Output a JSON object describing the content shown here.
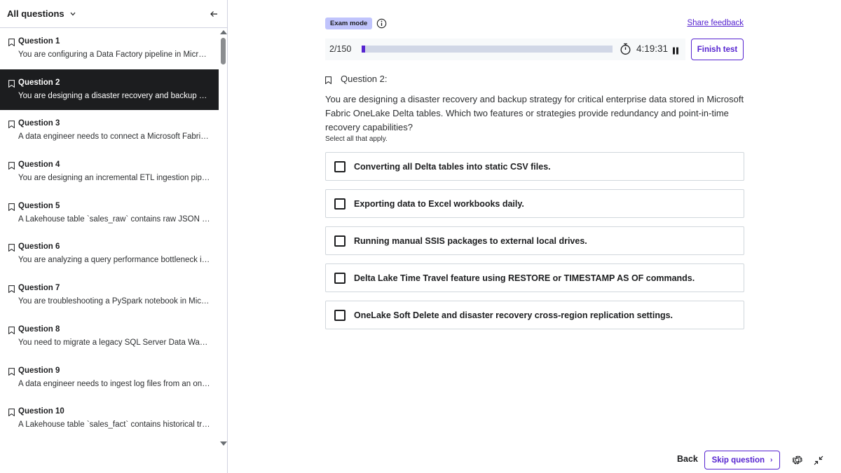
{
  "sidebar": {
    "title": "All questions",
    "questions": [
      {
        "title": "Question 1",
        "preview": "You are configuring a Data Factory pipeline in Microsoft Fabric to copy data"
      },
      {
        "title": "Question 2",
        "preview": "You are designing a disaster recovery and backup strategy for critical"
      },
      {
        "title": "Question 3",
        "preview": "A data engineer needs to connect a Microsoft Fabric Data Pipeline"
      },
      {
        "title": "Question 4",
        "preview": "You are designing an incremental ETL ingestion pipeline for"
      },
      {
        "title": "Question 5",
        "preview": "A Lakehouse table `sales_raw` contains raw JSON records"
      },
      {
        "title": "Question 6",
        "preview": "You are analyzing a query performance bottleneck in a Fabric"
      },
      {
        "title": "Question 7",
        "preview": "You are troubleshooting a PySpark notebook in Microsoft Fabric"
      },
      {
        "title": "Question 8",
        "preview": "You need to migrate a legacy SQL Server Data Warehouse"
      },
      {
        "title": "Question 9",
        "preview": "A data engineer needs to ingest log files from an on-premises"
      },
      {
        "title": "Question 10",
        "preview": "A Lakehouse table `sales_fact` contains historical transactions"
      }
    ],
    "active_index": 1
  },
  "header": {
    "exam_mode": "Exam mode",
    "share_feedback": "Share feedback",
    "progress_text": "2/150",
    "progress_fraction": 0.0133,
    "timer": "4:19:31",
    "finish_label": "Finish test"
  },
  "question": {
    "label": "Question 2:",
    "text": "You are designing a disaster recovery and backup strategy for critical enterprise data stored in Microsoft Fabric OneLake Delta tables. Which two features or strategies provide redundancy and point-in-time recovery capabilities?",
    "instruction": "Select all that apply.",
    "options": [
      "Converting all Delta tables into static CSV files.",
      "Exporting data to Excel workbooks daily.",
      "Running manual SSIS packages to external local drives.",
      "Delta Lake Time Travel feature using RESTORE or TIMESTAMP AS OF commands.",
      "OneLake Soft Delete and disaster recovery cross-region replication settings."
    ]
  },
  "footer": {
    "back_label": "Back",
    "skip_label": "Skip question",
    "skip_chevron": "›"
  },
  "colors": {
    "accent": "#5624d0",
    "badge": "#c0c4fc",
    "active_item": "#1c1d1f"
  }
}
